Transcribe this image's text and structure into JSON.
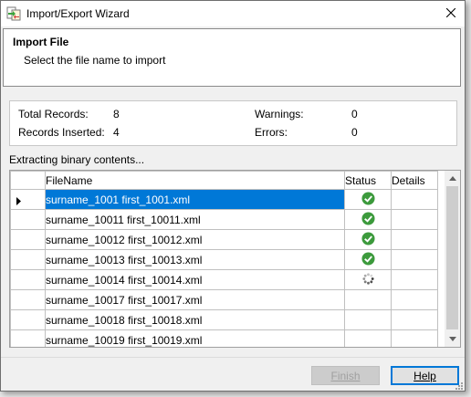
{
  "window": {
    "title": "Import/Export Wizard",
    "close_icon": "close-icon",
    "app_icon": "import-export-icon"
  },
  "header": {
    "title": "Import File",
    "subtitle": "Select the file name to import"
  },
  "stats": {
    "total_records_label": "Total Records:",
    "total_records_value": "8",
    "records_inserted_label": "Records Inserted:",
    "records_inserted_value": "4",
    "warnings_label": "Warnings:",
    "warnings_value": "0",
    "errors_label": "Errors:",
    "errors_value": "0"
  },
  "status_line": "Extracting binary contents...",
  "grid": {
    "columns": [
      "FileName",
      "Status",
      "Details"
    ],
    "rows": [
      {
        "file": "surname_1001 first_1001.xml",
        "status": "done",
        "selected": true
      },
      {
        "file": "surname_10011 first_10011.xml",
        "status": "done",
        "selected": false
      },
      {
        "file": "surname_10012 first_10012.xml",
        "status": "done",
        "selected": false
      },
      {
        "file": "surname_10013 first_10013.xml",
        "status": "done",
        "selected": false
      },
      {
        "file": "surname_10014 first_10014.xml",
        "status": "loading",
        "selected": false
      },
      {
        "file": "surname_10017 first_10017.xml",
        "status": "",
        "selected": false
      },
      {
        "file": "surname_10018 first_10018.xml",
        "status": "",
        "selected": false
      },
      {
        "file": "surname_10019 first_10019.xml",
        "status": "",
        "selected": false
      }
    ]
  },
  "buttons": {
    "finish_label": "Finish",
    "help_label": "Help"
  },
  "colors": {
    "selection": "#0078d7",
    "check": "#3c9a3c"
  }
}
